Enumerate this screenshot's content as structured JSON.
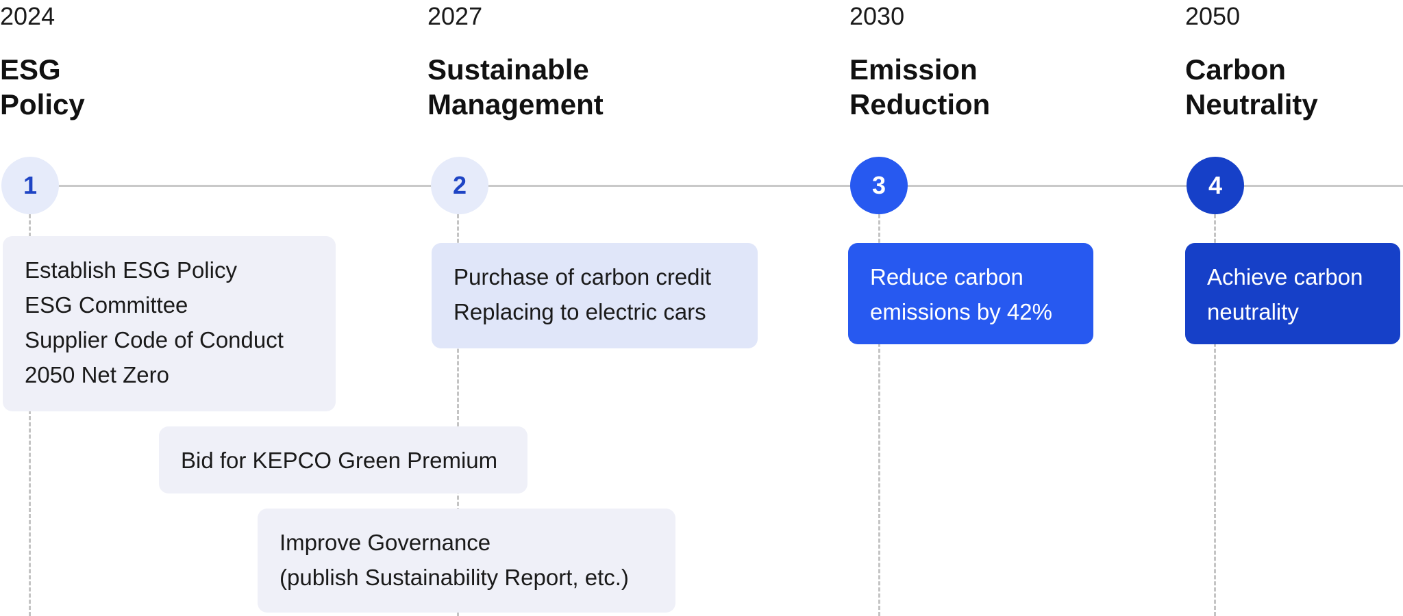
{
  "milestones": [
    {
      "number": "1",
      "year": "2024",
      "title_line1": "ESG",
      "title_line2": "Policy",
      "items": [
        "Establish ESG Policy",
        "ESG Committee",
        "Supplier Code of Conduct",
        "2050 Net Zero"
      ]
    },
    {
      "number": "2",
      "year": "2027",
      "title_line1": "Sustainable",
      "title_line2": "Management",
      "items": [
        "Purchase of carbon credit",
        "Replacing to electric cars"
      ]
    },
    {
      "number": "3",
      "year": "2030",
      "title_line1": "Emission",
      "title_line2": "Reduction",
      "items": [
        "Reduce carbon",
        "emissions by 42%"
      ]
    },
    {
      "number": "4",
      "year": "2050",
      "title_line1": "Carbon",
      "title_line2": "Neutrality",
      "items": [
        "Achieve carbon",
        "neutrality"
      ]
    }
  ],
  "extra_boxes": {
    "kepco": "Bid for KEPCO Green Premium",
    "governance_line1": "Improve Governance",
    "governance_line2": "(publish Sustainability Report, etc.)"
  },
  "colors": {
    "node_light": "#e6ebfa",
    "node_blue": "#2759f0",
    "node_dark_blue": "#1640c8",
    "box_gray": "#eff0f8",
    "box_light_blue": "#e0e6f9",
    "line": "#c9c9c9"
  }
}
